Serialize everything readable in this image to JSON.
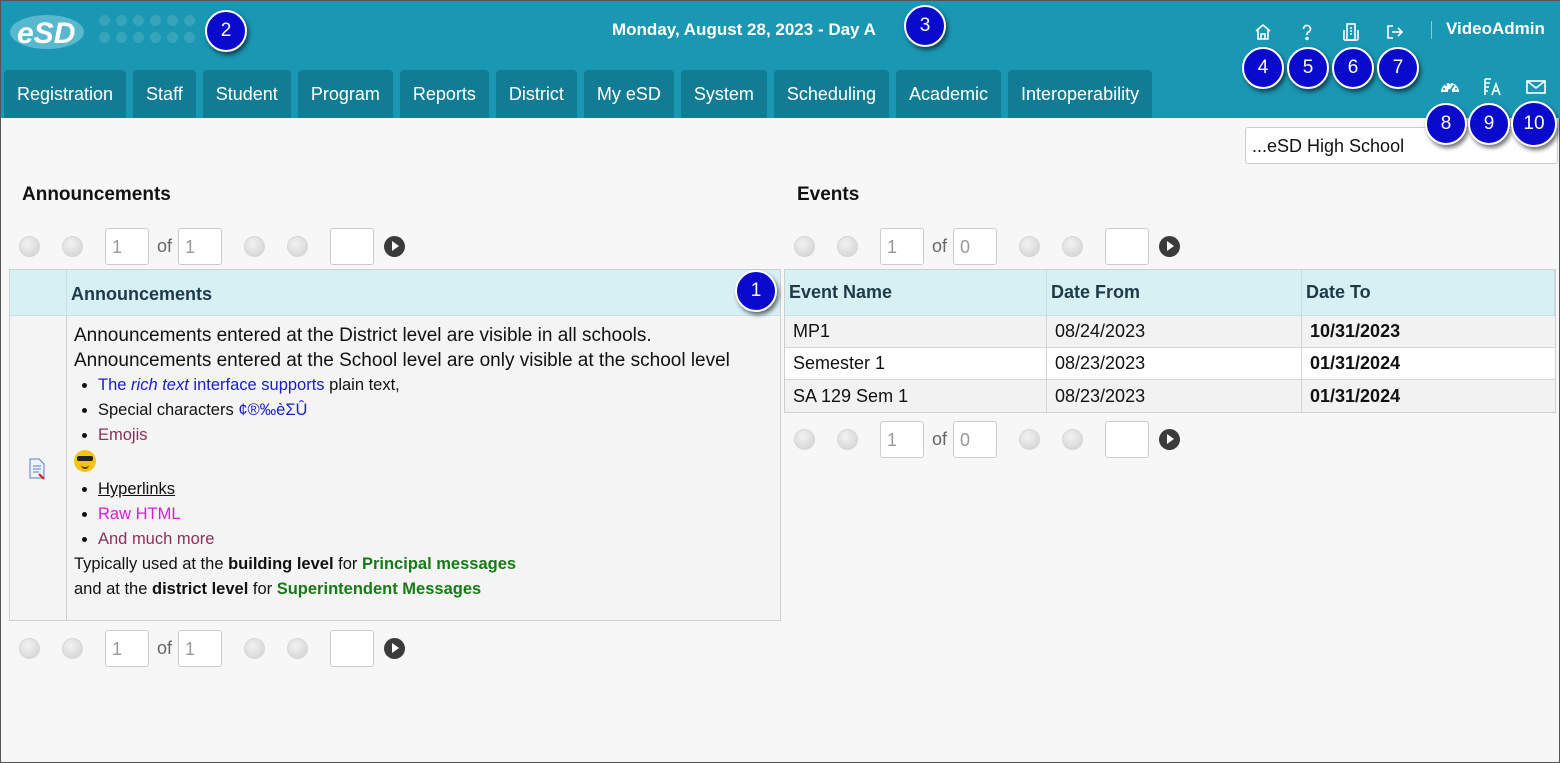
{
  "header": {
    "logo_text": "eSD",
    "date_line": "Monday, August 28, 2023 - Day A",
    "username": "VideoAdmin",
    "top_icons": [
      "home-icon",
      "help-icon",
      "building-icon",
      "logout-icon"
    ],
    "sub_icons": [
      "dashboard-icon",
      "font-settings-icon",
      "mail-icon"
    ]
  },
  "tabs": [
    "Registration",
    "Staff",
    "Student",
    "Program",
    "Reports",
    "District",
    "My eSD",
    "System",
    "Scheduling",
    "Academic",
    "Interoperability"
  ],
  "school_selector": {
    "value": "...eSD High School"
  },
  "markers": [
    "1",
    "2",
    "3",
    "4",
    "5",
    "6",
    "7",
    "8",
    "9",
    "10"
  ],
  "announcements": {
    "section_title": "Announcements",
    "column_header": "Announcements",
    "pager_top": {
      "page": "1",
      "of_label": "of",
      "total": "1",
      "goto": ""
    },
    "pager_bottom": {
      "page": "1",
      "of_label": "of",
      "total": "1",
      "goto": ""
    },
    "content": {
      "line1": "Announcements entered at the District level are visible in all schools.",
      "line2": "Announcements entered at the School level are only visible at the school level",
      "bullet1_a": "The ",
      "bullet1_b": "rich text",
      "bullet1_c": " interface supports",
      "bullet1_d": " plain text,",
      "bullet2_a": "Special characters ",
      "bullet2_b": "¢®‰èΣÛ",
      "bullet3": "Emojis",
      "bullet4": "Hyperlinks",
      "bullet5": "Raw HTML",
      "bullet6": "And much more",
      "tail1_a": "Typically used at the ",
      "tail1_b": "building level",
      "tail1_c": " for ",
      "tail1_d": "Principal messages",
      "tail2_a": "and at the ",
      "tail2_b": "district level",
      "tail2_c": " for ",
      "tail2_d": "Superintendent Messages"
    }
  },
  "events": {
    "section_title": "Events",
    "pager_top": {
      "page": "1",
      "of_label": "of",
      "total": "0",
      "goto": ""
    },
    "pager_bottom": {
      "page": "1",
      "of_label": "of",
      "total": "0",
      "goto": ""
    },
    "columns": [
      "Event Name",
      "Date From",
      "Date To"
    ],
    "rows": [
      {
        "name": "MP1",
        "from": "08/24/2023",
        "to": "10/31/2023"
      },
      {
        "name": "Semester 1",
        "from": "08/23/2023",
        "to": "01/31/2024"
      },
      {
        "name": "SA 129 Sem 1",
        "from": "08/23/2023",
        "to": "01/31/2024"
      }
    ]
  }
}
